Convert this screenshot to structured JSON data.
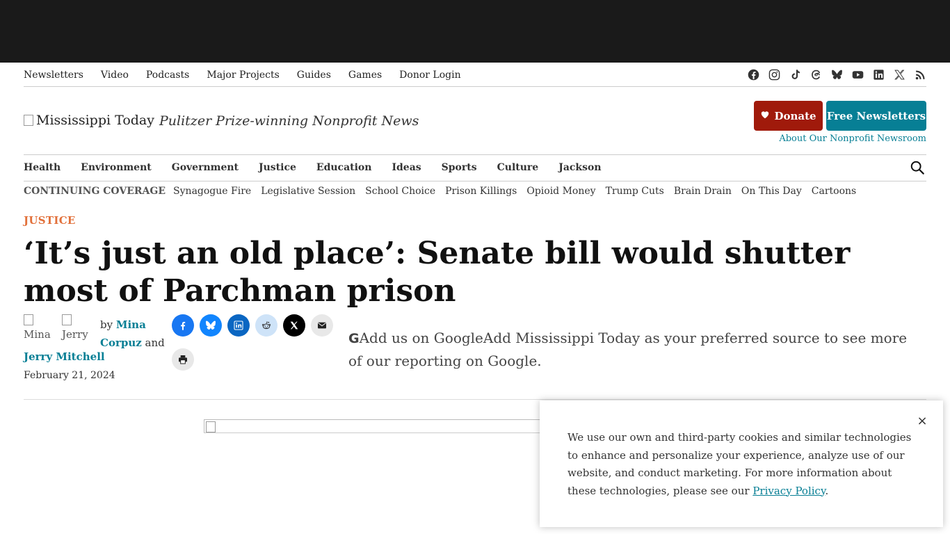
{
  "utility_nav": [
    "Newsletters",
    "Video",
    "Podcasts",
    "Major Projects",
    "Guides",
    "Games",
    "Donor Login"
  ],
  "social_icons": [
    "facebook-icon",
    "instagram-icon",
    "tiktok-icon",
    "threads-icon",
    "bluesky-icon",
    "youtube-icon",
    "linkedin-icon",
    "x-icon",
    "rss-icon"
  ],
  "masthead": {
    "logo_alt": "Mississippi Today",
    "tagline": "Pulitzer Prize-winning Nonprofit News",
    "donate_label": "Donate",
    "newsletters_label": "Free Newsletters",
    "about_link": "About Our Nonprofit Newsroom"
  },
  "main_nav": [
    "Health",
    "Environment",
    "Government",
    "Justice",
    "Education",
    "Ideas",
    "Sports",
    "Culture",
    "Jackson"
  ],
  "coverage": {
    "label": "CONTINUING COVERAGE",
    "items": [
      "Synagogue Fire",
      "Legislative Session",
      "School Choice",
      "Prison Killings",
      "Opioid Money",
      "Trump Cuts",
      "Brain Drain",
      "On This Day",
      "Cartoons"
    ]
  },
  "article": {
    "kicker": "JUSTICE",
    "headline": "‘It’s just an old place’: Senate bill would shutter most of Parchman prison",
    "avatar1_alt": "Mina",
    "avatar2_alt": "Jerry",
    "by": "by",
    "author1": "Mina Corpuz",
    "and": "and",
    "author2": "Jerry Mitchell",
    "date": "February 21, 2024"
  },
  "share_icons": [
    "facebook-share-icon",
    "bluesky-share-icon",
    "linkedin-share-icon",
    "reddit-share-icon",
    "x-share-icon",
    "email-share-icon",
    "print-icon"
  ],
  "google_pref": {
    "g": "G",
    "text": "Add us on GoogleAdd Mississippi Today as your preferred source to see more of our reporting on Google."
  },
  "cookie": {
    "text": "We use our own and third-party cookies and similar technologies to enhance and personalize your experience, analyze use of our website, and conduct marketing. For more information about these technologies, please see our ",
    "link": "Privacy Policy",
    "end": ".",
    "close": "×"
  },
  "colors": {
    "accent_teal": "#077f95",
    "donate_red": "#a01a0b",
    "kicker_orange": "#e2703a",
    "topbar": "#1a1a1a"
  }
}
